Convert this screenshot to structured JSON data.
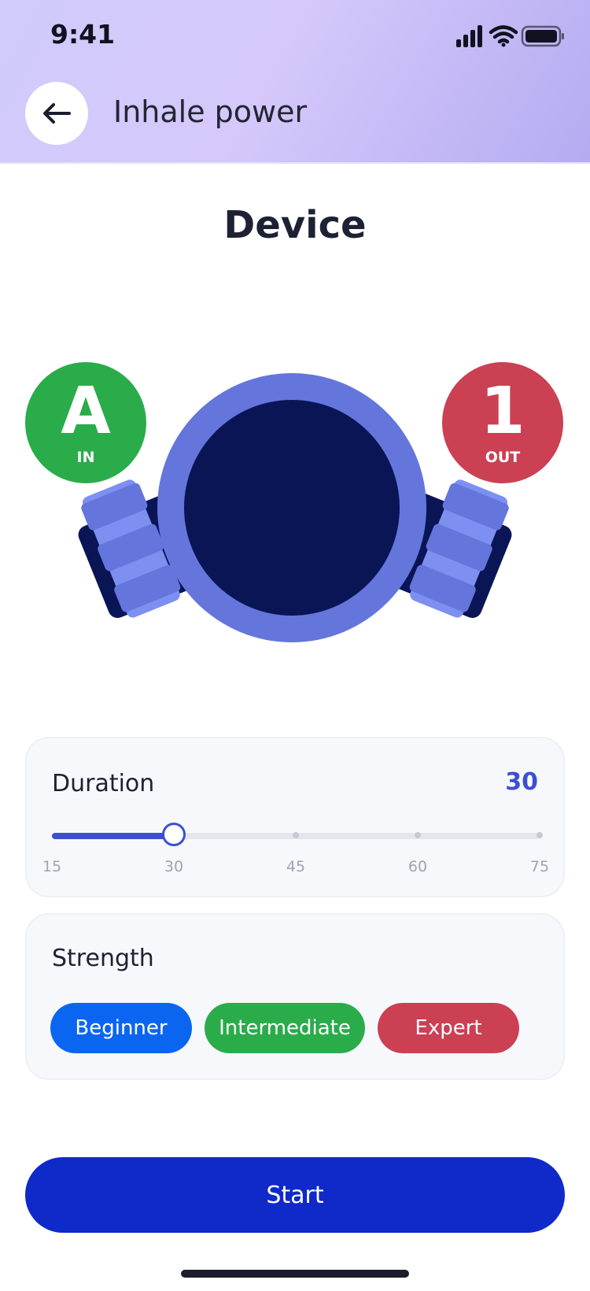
{
  "status_bar": {
    "time": "9:41"
  },
  "header": {
    "title": "Inhale power",
    "back_icon": "arrow-left-icon"
  },
  "page": {
    "title": "Device"
  },
  "device": {
    "in_badge": {
      "letter": "A",
      "label": "IN",
      "color": "#2aac4a"
    },
    "out_badge": {
      "letter": "1",
      "label": "OUT",
      "color": "#cb4053"
    }
  },
  "duration": {
    "label": "Duration",
    "value": "30",
    "min": 15,
    "max": 75,
    "current": 30,
    "ticks": [
      "15",
      "30",
      "45",
      "60",
      "75"
    ]
  },
  "strength": {
    "label": "Strength",
    "options": [
      {
        "label": "Beginner",
        "color": "#0a66f0"
      },
      {
        "label": "Intermediate",
        "color": "#2aac4a"
      },
      {
        "label": "Expert",
        "color": "#cb4053"
      }
    ]
  },
  "start_button": {
    "label": "Start",
    "color": "#1029c9"
  },
  "colors": {
    "accent": "#3d4fd1",
    "device_ring": "#6476dc",
    "device_core": "#0a1556"
  }
}
